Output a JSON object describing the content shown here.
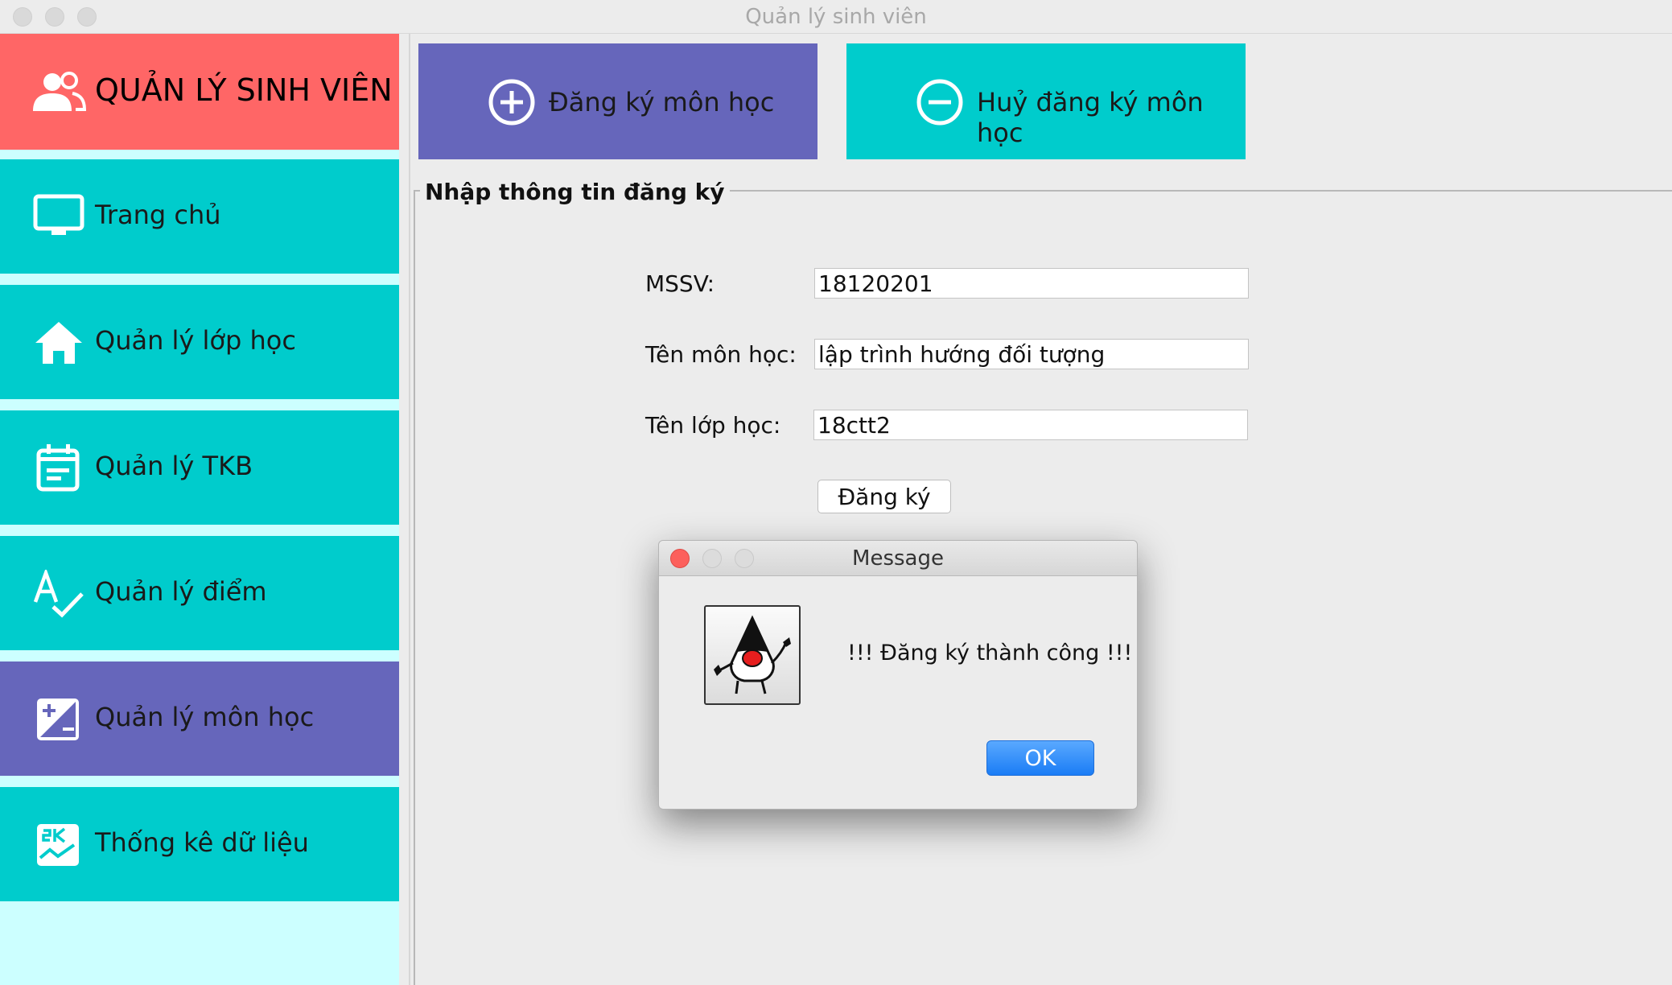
{
  "window": {
    "title": "Quản lý sinh viên"
  },
  "sidebar": {
    "app_title": "QUẢN LÝ SINH VIÊN",
    "items": [
      {
        "label": "Trang chủ",
        "icon": "monitor-icon"
      },
      {
        "label": "Quản lý lớp học",
        "icon": "home-icon"
      },
      {
        "label": "Quản lý TKB",
        "icon": "calendar-icon"
      },
      {
        "label": "Quản lý điểm",
        "icon": "grade-check-icon"
      },
      {
        "label": "Quản lý môn học",
        "icon": "plus-minus-icon",
        "active": true
      },
      {
        "label": "Thống kê dữ liệu",
        "icon": "statistics-icon"
      }
    ]
  },
  "actions": {
    "register_label": "Đăng ký môn học",
    "unregister_label": "Huỷ đăng ký môn học"
  },
  "form": {
    "group_title": "Nhập thông tin đăng ký",
    "mssv_label": "MSSV:",
    "mssv_value": "18120201",
    "subject_label": "Tên môn học:",
    "subject_value": "lập trình hướng đối tượng",
    "class_label": "Tên lớp học:",
    "class_value": "18ctt2",
    "submit_label": "Đăng ký"
  },
  "dialog": {
    "title": "Message",
    "message": "!!! Đăng ký thành công !!!",
    "ok_label": "OK"
  },
  "colors": {
    "sidebar_header": "#ff6666",
    "nav_item": "#00cccc",
    "nav_active": "#6666bb",
    "sidebar_bg": "#ccffff",
    "register_button": "#6666bb",
    "unregister_button": "#00cccc",
    "ok_button": "#1a7cf5"
  }
}
